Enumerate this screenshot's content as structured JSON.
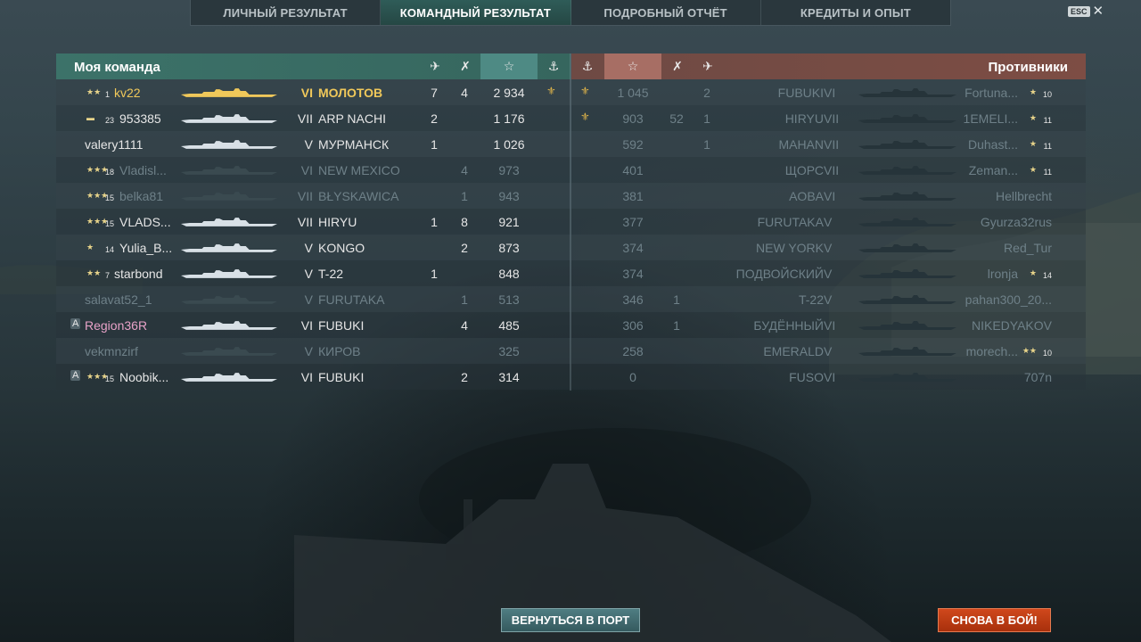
{
  "tabs": [
    {
      "label": "ЛИЧНЫЙ РЕЗУЛЬТАТ"
    },
    {
      "label": "КОМАНДНЫЙ РЕЗУЛЬТАТ"
    },
    {
      "label": "ПОДРОБНЫЙ ОТЧЁТ"
    },
    {
      "label": "КРЕДИТЫ И ОПЫТ"
    }
  ],
  "esc": {
    "key": "ESC"
  },
  "left_team": {
    "title": "Моя команда",
    "rows": [
      {
        "rank_badge": "★★",
        "level": "1",
        "player": "kv22",
        "tier": "VI",
        "ship": "МОЛОТОВ",
        "planes": "7",
        "ships": "4",
        "xp": "2 934",
        "medal": "⚜",
        "highlight": true
      },
      {
        "rank_badge": "▬",
        "level": "23",
        "player": "953385",
        "tier": "VII",
        "ship": "ARP NACHI",
        "planes": "2",
        "ships": "",
        "xp": "1 176",
        "medal": ""
      },
      {
        "rank_badge": "",
        "level": "",
        "player": "valery1111",
        "tier": "V",
        "ship": "МУРМАНСК",
        "planes": "1",
        "ships": "",
        "xp": "1 026",
        "medal": ""
      },
      {
        "rank_badge": "★★★",
        "level": "18",
        "player": "Vladisl...",
        "tier": "VI",
        "ship": "NEW MEXICO",
        "planes": "",
        "ships": "4",
        "xp": "973",
        "medal": "",
        "dim": true
      },
      {
        "rank_badge": "★★★",
        "level": "15",
        "player": "belka81",
        "tier": "VII",
        "ship": "BŁYSKAWICA",
        "planes": "",
        "ships": "1",
        "xp": "943",
        "medal": "",
        "dim": true
      },
      {
        "rank_badge": "★★★",
        "level": "15",
        "player": "VLADS...",
        "tier": "VII",
        "ship": "HIRYU",
        "planes": "1",
        "ships": "8",
        "xp": "921",
        "medal": ""
      },
      {
        "rank_badge": "★",
        "level": "14",
        "player": "Yulia_B...",
        "tier": "V",
        "ship": "KONGO",
        "planes": "",
        "ships": "2",
        "xp": "873",
        "medal": ""
      },
      {
        "rank_badge": "★★",
        "level": "7",
        "player": "starbond",
        "tier": "V",
        "ship": "T-22",
        "planes": "1",
        "ships": "",
        "xp": "848",
        "medal": ""
      },
      {
        "rank_badge": "",
        "level": "",
        "player": "salavat52_1",
        "tier": "V",
        "ship": "FURUTAKA",
        "planes": "",
        "ships": "1",
        "xp": "513",
        "medal": "",
        "dim": true
      },
      {
        "rank_badge": "",
        "level": "",
        "player": "Region36R",
        "tier": "VI",
        "ship": "FUBUKI",
        "planes": "",
        "ships": "4",
        "xp": "485",
        "medal": "",
        "clan": "A",
        "pink": true
      },
      {
        "rank_badge": "",
        "level": "",
        "player": "vekmnzirf",
        "tier": "V",
        "ship": "КИРОВ",
        "planes": "",
        "ships": "",
        "xp": "325",
        "medal": "",
        "dim": true
      },
      {
        "rank_badge": "★★★",
        "level": "15",
        "player": "Noobik...",
        "tier": "VI",
        "ship": "FUBUKI",
        "planes": "",
        "ships": "2",
        "xp": "314",
        "medal": "",
        "clan": "A"
      }
    ]
  },
  "right_team": {
    "title": "Противники",
    "rows": [
      {
        "medal": "⚜",
        "xp": "1 045",
        "ships": "",
        "planes": "2",
        "ship": "FUBUKI",
        "tier": "VI",
        "player": "Fortuna...",
        "rank_badge": "★",
        "level": "10",
        "dim": true
      },
      {
        "medal": "⚜",
        "xp": "903",
        "ships": "52",
        "planes": "1",
        "ship": "HIRYU",
        "tier": "VII",
        "player": "1EMELI...",
        "rank_badge": "★",
        "level": "11",
        "dim": true
      },
      {
        "medal": "",
        "xp": "592",
        "ships": "",
        "planes": "1",
        "ship": "MAHAN",
        "tier": "VII",
        "player": "Duhast...",
        "rank_badge": "★",
        "level": "11",
        "dim": true
      },
      {
        "medal": "",
        "xp": "401",
        "ships": "",
        "planes": "",
        "ship": "ЩОРС",
        "tier": "VII",
        "player": "Zeman...",
        "rank_badge": "★",
        "level": "11",
        "dim": true
      },
      {
        "medal": "",
        "xp": "381",
        "ships": "",
        "planes": "",
        "ship": "AOBA",
        "tier": "VI",
        "player": "Hellbrecht",
        "rank_badge": "",
        "level": "",
        "dim": true
      },
      {
        "medal": "",
        "xp": "377",
        "ships": "",
        "planes": "",
        "ship": "FURUTAKA",
        "tier": "V",
        "player": "Gyurza32rus",
        "rank_badge": "",
        "level": "",
        "dim": true
      },
      {
        "medal": "",
        "xp": "374",
        "ships": "",
        "planes": "",
        "ship": "NEW YORK",
        "tier": "V",
        "player": "Red_Tur",
        "rank_badge": "",
        "level": "",
        "dim": true
      },
      {
        "medal": "",
        "xp": "374",
        "ships": "",
        "planes": "",
        "ship": "ПОДВОЙСКИЙ",
        "tier": "V",
        "player": "lronja",
        "rank_badge": "★",
        "level": "14",
        "dim": true
      },
      {
        "medal": "",
        "xp": "346",
        "ships": "1",
        "planes": "",
        "ship": "T-22",
        "tier": "V",
        "player": "pahan300_20...",
        "rank_badge": "",
        "level": "",
        "dim": true
      },
      {
        "medal": "",
        "xp": "306",
        "ships": "1",
        "planes": "",
        "ship": "БУДЁННЫЙ",
        "tier": "VI",
        "player": "NIKEDYAKOV",
        "rank_badge": "",
        "level": "",
        "dim": true
      },
      {
        "medal": "",
        "xp": "258",
        "ships": "",
        "planes": "",
        "ship": "EMERALD",
        "tier": "V",
        "player": "morech...",
        "rank_badge": "★★",
        "level": "10",
        "dim": true
      },
      {
        "medal": "",
        "xp": "0",
        "ships": "",
        "planes": "",
        "ship": "FUSO",
        "tier": "VI",
        "player": "707n",
        "rank_badge": "",
        "level": "",
        "dim": true
      }
    ]
  },
  "header_icons": {
    "planes": "plane-icon",
    "ships": "crossed-swords-icon",
    "xp": "star-icon",
    "medal": "anchor-medal-icon"
  },
  "buttons": {
    "port": "ВЕРНУТЬСЯ В ПОРТ",
    "battle": "СНОВА В БОЙ!"
  },
  "colors": {
    "ally_header": "#3c7269",
    "enemy_header": "#7d4d44",
    "highlight_player": "#f0c85a",
    "battle_button": "#c23e14"
  }
}
